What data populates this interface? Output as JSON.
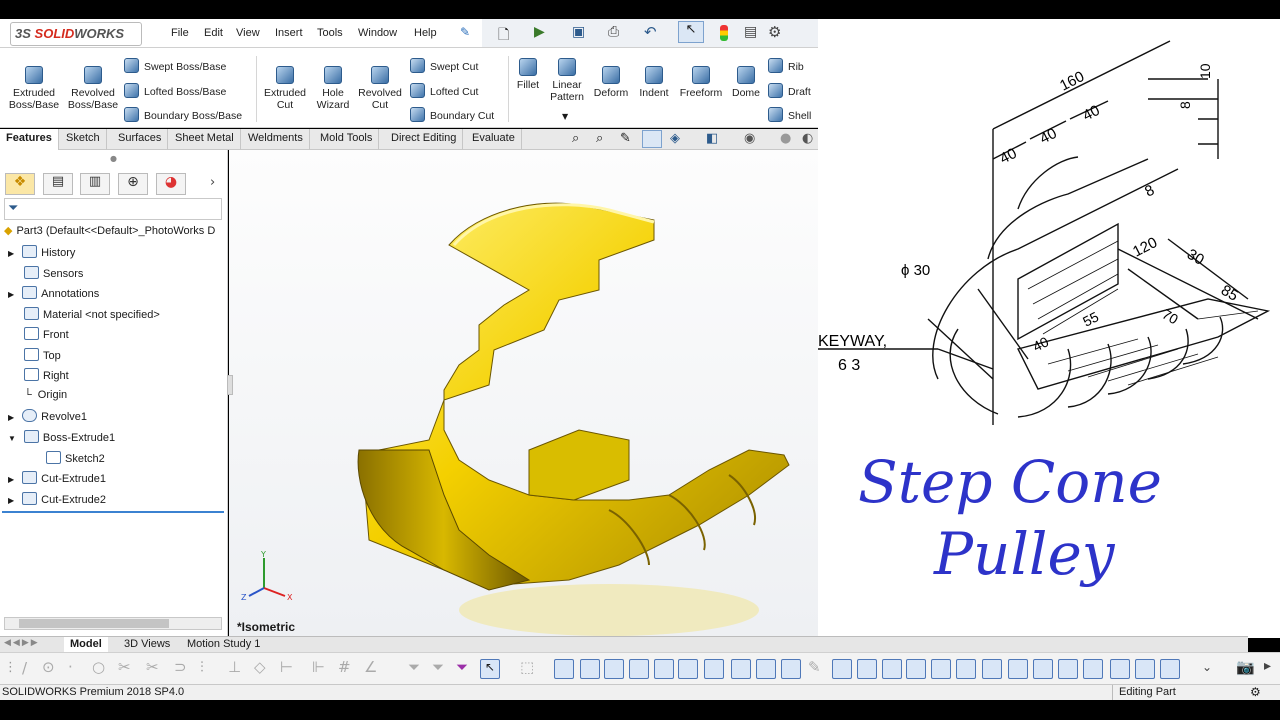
{
  "app": {
    "logo_ds": "3S",
    "logo_solid": "SOLID",
    "logo_works": "WORKS"
  },
  "menu": [
    "File",
    "Edit",
    "View",
    "Insert",
    "Tools",
    "Window",
    "Help"
  ],
  "ribbon": {
    "extruded_boss": "Extruded Boss/Base",
    "revolved_boss": "Revolved Boss/Base",
    "swept_boss": "Swept Boss/Base",
    "lofted_boss": "Lofted Boss/Base",
    "boundary_boss": "Boundary Boss/Base",
    "extruded_cut": "Extruded Cut",
    "hole_wizard": "Hole Wizard",
    "revolved_cut": "Revolved Cut",
    "swept_cut": "Swept Cut",
    "lofted_cut": "Lofted Cut",
    "boundary_cut": "Boundary Cut",
    "fillet": "Fillet",
    "linear_pattern": "Linear Pattern",
    "deform": "Deform",
    "indent": "Indent",
    "freeform": "Freeform",
    "dome": "Dome",
    "rib": "Rib",
    "draft": "Draft",
    "shell": "Shell"
  },
  "tabs": [
    "Features",
    "Sketch",
    "Surfaces",
    "Sheet Metal",
    "Weldments",
    "Mold Tools",
    "Direct Editing",
    "Evaluate"
  ],
  "tree": {
    "part": "Part3  (Default<<Default>_PhotoWorks D",
    "items": [
      "History",
      "Sensors",
      "Annotations",
      "Material <not specified>",
      "Front",
      "Top",
      "Right",
      "Origin",
      "Revolve1",
      "Boss-Extrude1",
      "Sketch2",
      "Cut-Extrude1",
      "Cut-Extrude2"
    ]
  },
  "viewport": {
    "view_label": "*Isometric",
    "axis_y": "Y",
    "axis_x": "X",
    "axis_z": "Z"
  },
  "drawing": {
    "dims": [
      "160",
      "10",
      "8",
      "40",
      "40",
      "40",
      "8",
      "120",
      "30",
      "85",
      "55",
      "70",
      "40"
    ],
    "phi": "ϕ 30",
    "keyway": "KEYWAY,",
    "keyway_dims": "6    3"
  },
  "title": {
    "line1": "Step Cone",
    "line2": "Pulley"
  },
  "bottom_tabs": [
    "Model",
    "3D Views",
    "Motion Study 1"
  ],
  "status": {
    "left": "SOLIDWORKS Premium 2018 SP4.0",
    "right": "Editing Part"
  },
  "colors": {
    "accent": "#2d33c9",
    "part_gold": "#f4d000",
    "logo_red": "#d52b1e"
  }
}
